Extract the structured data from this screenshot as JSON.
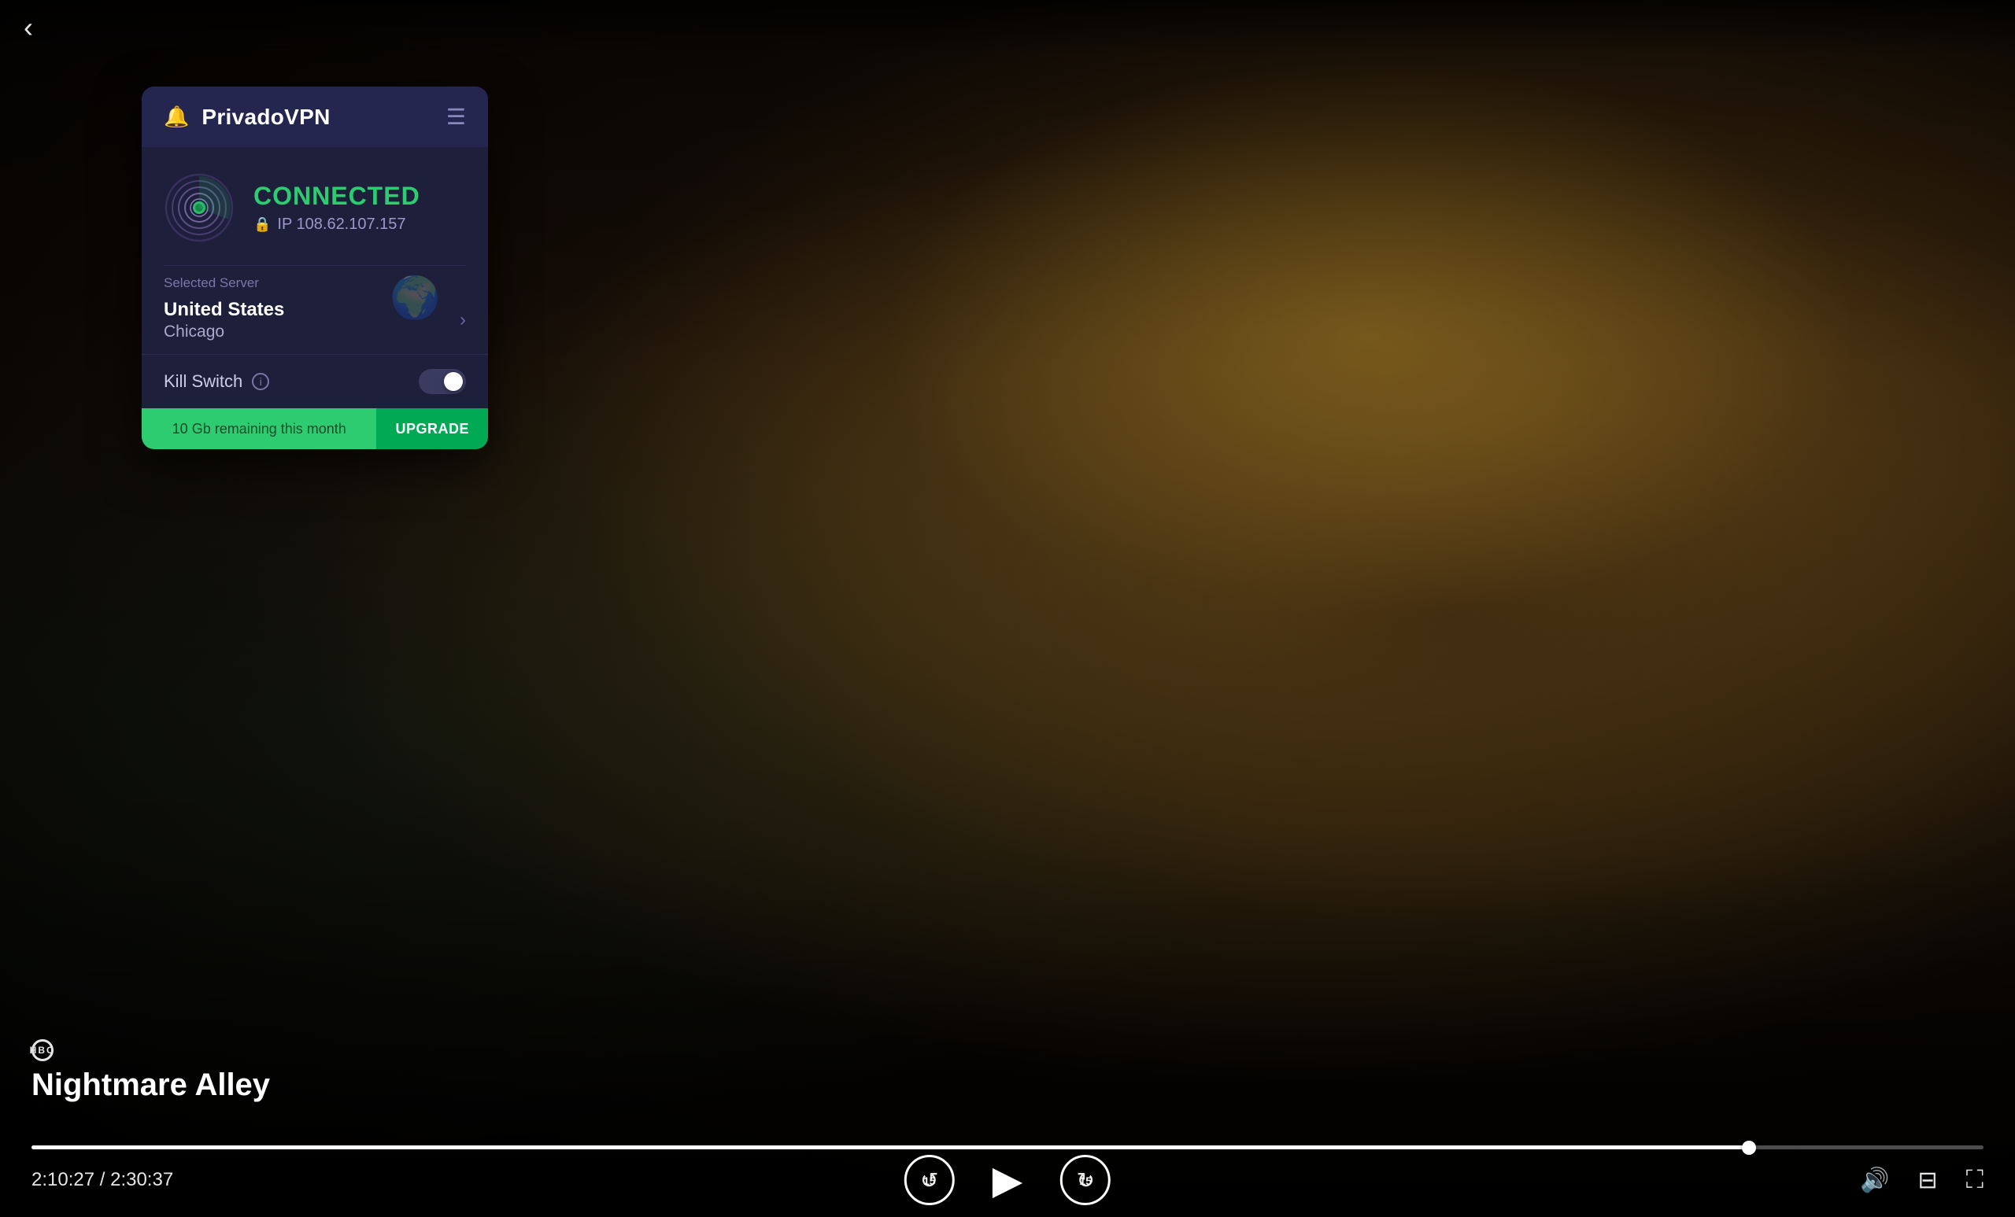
{
  "app": {
    "back_label": "‹"
  },
  "vpn": {
    "title": "PrivadoVPN",
    "status": "CONNECTED",
    "ip_label": "IP 108.62.107.157",
    "server_section_label": "Selected Server",
    "server_country": "United States",
    "server_city": "Chicago",
    "killswitch_label": "Kill Switch",
    "banner_data": "10 Gb remaining this month",
    "banner_upgrade": "UPGRADE",
    "toggle_state": "off"
  },
  "player": {
    "show_network": "HBO",
    "show_title": "Nightmare Alley",
    "time_current": "2:10:27",
    "time_separator": " / ",
    "time_total": "2:30:37",
    "progress_percent": 88,
    "skip_back_label": "15",
    "skip_forward_label": "15"
  }
}
